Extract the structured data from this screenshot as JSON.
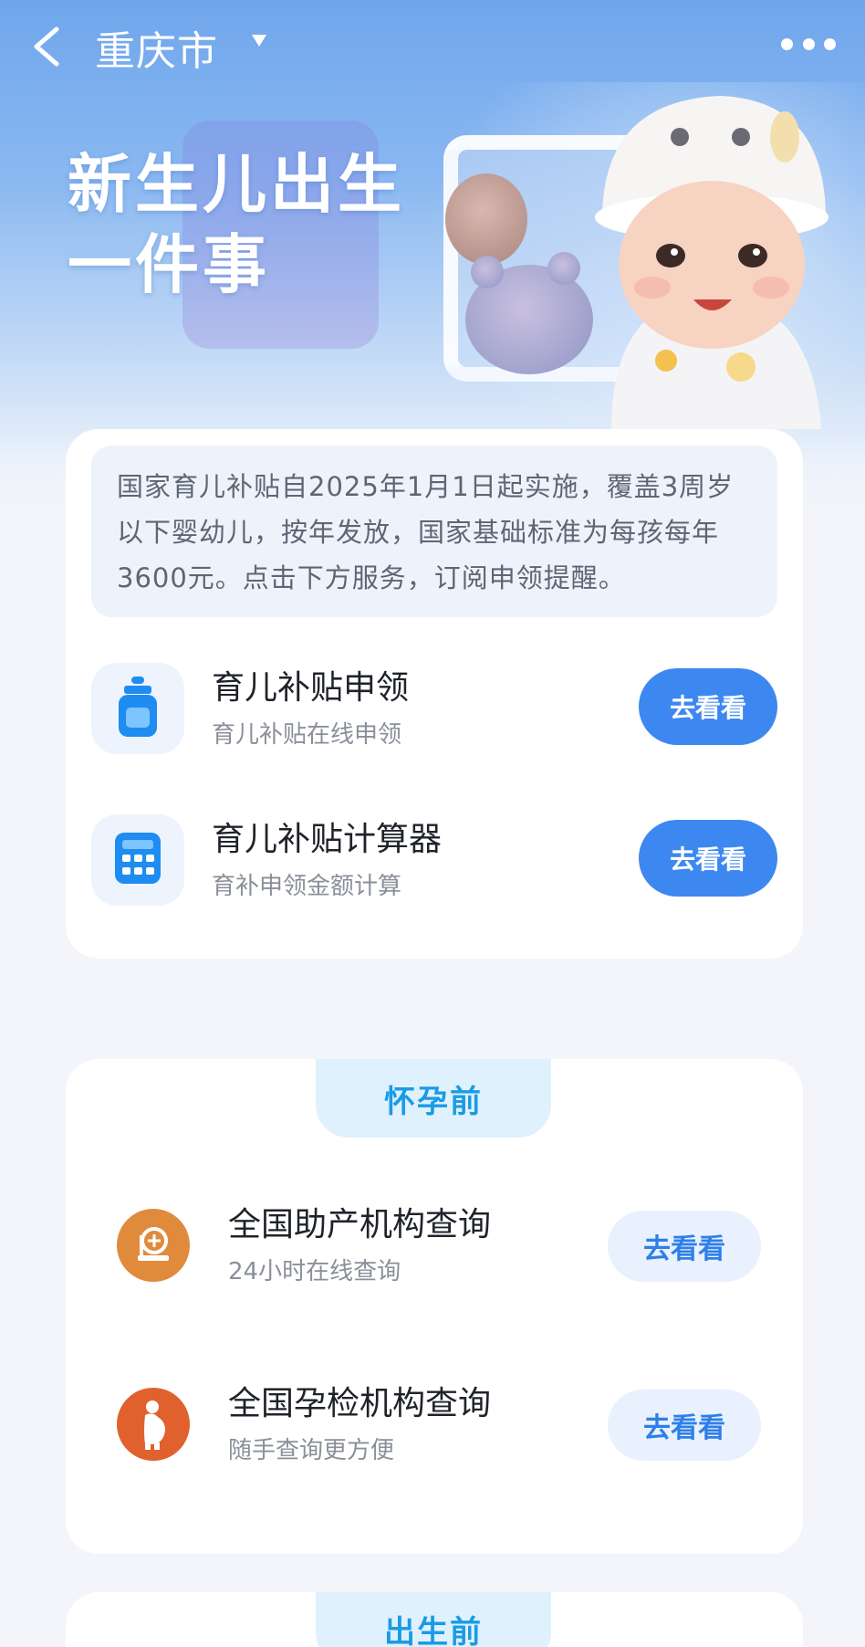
{
  "nav": {
    "city": "重庆市"
  },
  "hero": {
    "title_line1": "新生儿出生",
    "title_line2": "一件事"
  },
  "notice": {
    "text": "国家育儿补贴自2025年1月1日起实施，覆盖3周岁以下婴幼儿，按年发放，国家基础标准为每孩每年3600元。点击下方服务，订阅申领提醒。"
  },
  "services": [
    {
      "title": "育儿补贴申领",
      "subtitle": "育儿补贴在线申领",
      "button": "去看看",
      "icon": "baby-bottle-icon"
    },
    {
      "title": "育儿补贴计算器",
      "subtitle": "育补申领金额计算",
      "button": "去看看",
      "icon": "calculator-icon"
    }
  ],
  "sections": [
    {
      "tab": "怀孕前",
      "items": [
        {
          "title": "全国助产机构查询",
          "subtitle": "24小时在线查询",
          "button": "去看看",
          "icon": "maternity-hospital-icon",
          "color": "#e08a3c"
        },
        {
          "title": "全国孕检机构查询",
          "subtitle": "随手查询更方便",
          "button": "去看看",
          "icon": "pregnant-woman-icon",
          "color": "#e0612e"
        }
      ]
    },
    {
      "tab": "出生前"
    }
  ],
  "colors": {
    "accent": "#3d88f0",
    "tab_text": "#1b9be4",
    "tab_bg": "#dff1fd"
  }
}
